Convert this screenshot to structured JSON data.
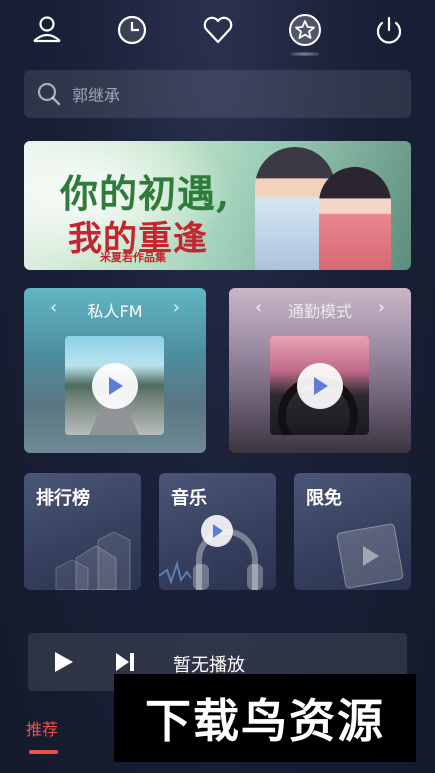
{
  "topbar": {
    "icons": [
      "user-icon",
      "clock-icon",
      "heart-icon",
      "star-icon",
      "power-icon"
    ],
    "active_icon": "star-icon"
  },
  "search": {
    "placeholder": "郭继承",
    "icon": "search-icon"
  },
  "banner": {
    "line1": "你的初遇,",
    "line2": "我的重逢",
    "sub": "米夏若作品集"
  },
  "cards": {
    "fm": {
      "title": "私人FM",
      "prev": "‹",
      "next": "›"
    },
    "commute": {
      "title": "通勤模式",
      "prev": "‹",
      "next": "›"
    }
  },
  "tiles": {
    "rank": "排行榜",
    "music": "音乐",
    "free": "限免"
  },
  "player": {
    "status": "暂无播放"
  },
  "tabs": {
    "recommend": "推荐"
  },
  "watermark": {
    "text": "下载鸟资源"
  },
  "colors": {
    "accent": "#e8534d",
    "background": "#1a2138"
  }
}
